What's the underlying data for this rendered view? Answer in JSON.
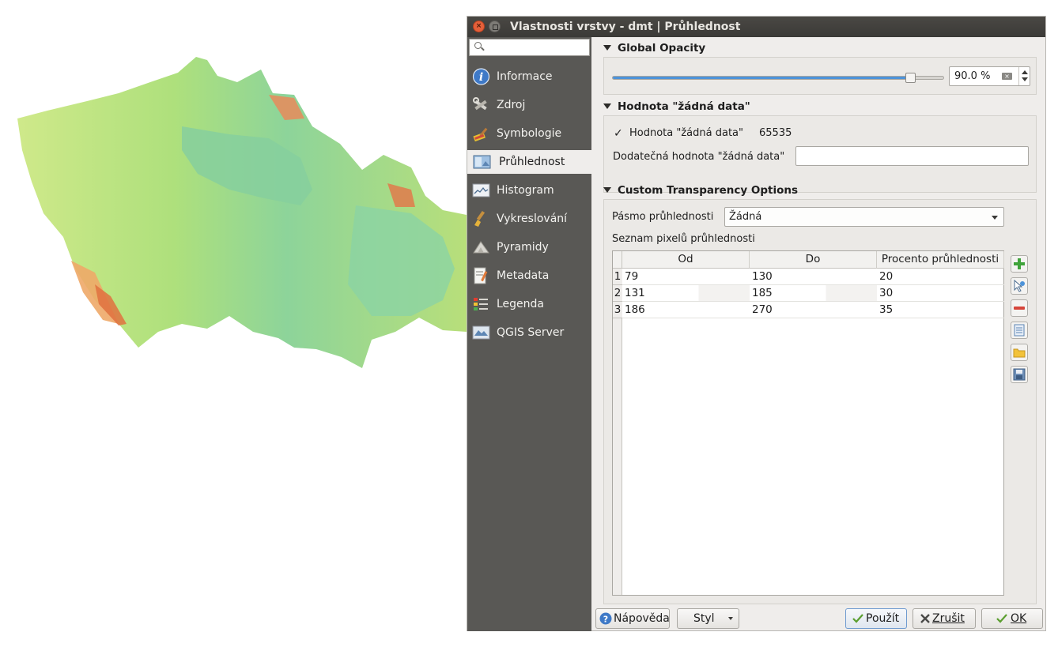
{
  "window": {
    "title": "Vlastnosti vrstvy - dmt | Průhlednost"
  },
  "sidebar": {
    "search_placeholder": "",
    "items": [
      {
        "label": "Informace",
        "icon": "info-icon"
      },
      {
        "label": "Zdroj",
        "icon": "source-tools-icon"
      },
      {
        "label": "Symbologie",
        "icon": "symbology-brush-icon"
      },
      {
        "label": "Průhlednost",
        "icon": "transparency-icon",
        "active": true
      },
      {
        "label": "Histogram",
        "icon": "histogram-icon"
      },
      {
        "label": "Vykreslování",
        "icon": "rendering-brush-icon"
      },
      {
        "label": "Pyramidy",
        "icon": "pyramids-icon"
      },
      {
        "label": "Metadata",
        "icon": "metadata-icon"
      },
      {
        "label": "Legenda",
        "icon": "legend-icon"
      },
      {
        "label": "QGIS Server",
        "icon": "qgis-server-icon"
      }
    ]
  },
  "global_opacity": {
    "header": "Global Opacity",
    "value_text": "90.0 %",
    "value": 0.9
  },
  "nodata": {
    "header": "Hodnota \"žádná data\"",
    "checkbox_label": "Hodnota \"žádná data\"",
    "checked": true,
    "checkmark": "✓",
    "value": "65535",
    "additional_label": "Dodatečná hodnota \"žádná data\"",
    "additional_value": ""
  },
  "custom": {
    "header": "Custom Transparency Options",
    "band_label": "Pásmo průhlednosti",
    "band_value": "Žádná",
    "list_label": "Seznam pixelů průhlednosti",
    "columns": [
      "Od",
      "Do",
      "Procento průhlednosti"
    ],
    "rows": [
      {
        "num": "1",
        "from": "79",
        "to": "130",
        "percent": "20"
      },
      {
        "num": "2",
        "from": "131",
        "to": "185",
        "percent": "30"
      },
      {
        "num": "3",
        "from": "186",
        "to": "270",
        "percent": "35"
      }
    ]
  },
  "buttons": {
    "help": "Nápověda",
    "style": "Styl",
    "apply": "Použít",
    "cancel": "Zrušit",
    "ok": "OK"
  },
  "colors": {
    "accent": "#4d93d9",
    "sidebar": "#595855",
    "map_low": "#8fd4a0",
    "map_mid": "#b8e27a",
    "map_high": "#e87a4a"
  }
}
